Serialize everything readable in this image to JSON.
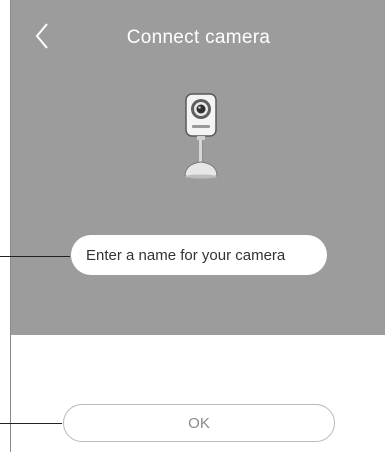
{
  "header": {
    "title": "Connect camera",
    "back_icon": "chevron-left-icon"
  },
  "camera": {
    "icon": "camera-icon"
  },
  "name_field": {
    "placeholder": "Enter a name for your camera",
    "value": ""
  },
  "footer": {
    "ok_label": "OK"
  },
  "colors": {
    "panel_bg": "#9c9c9c",
    "page_bg": "#ffffff",
    "title_text": "#ffffff",
    "button_border": "#b9b9b9",
    "button_text": "#8a8a8a"
  }
}
